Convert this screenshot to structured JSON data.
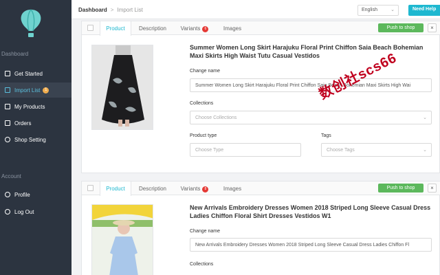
{
  "sidebar": {
    "section_dashboard": "Dashboard",
    "section_account": "Account",
    "items": [
      {
        "label": "Get Started",
        "icon": "external-link-icon"
      },
      {
        "label": "Import List",
        "icon": "list-icon",
        "badge": "1"
      },
      {
        "label": "My Products",
        "icon": "box-icon"
      },
      {
        "label": "Orders",
        "icon": "cart-icon"
      },
      {
        "label": "Shop Setting",
        "icon": "gear-icon"
      }
    ],
    "account_items": [
      {
        "label": "Profile",
        "icon": "user-icon"
      },
      {
        "label": "Log Out",
        "icon": "power-icon"
      }
    ]
  },
  "topbar": {
    "breadcrumb_root": "Dashboard",
    "breadcrumb_sep": ">",
    "breadcrumb_current": "Import List",
    "language": "English",
    "help_label": "Need Help"
  },
  "products": [
    {
      "tabs": {
        "product": "Product",
        "description": "Description",
        "variants": "Variants",
        "variants_count": "6",
        "images": "Images"
      },
      "push_label": "Push to shop",
      "close_label": "×",
      "title": "Summer Women Long Skirt Harajuku Floral Print Chiffon Saia Beach Bohemian Maxi Skirts High Waist Tutu Casual Vestidos",
      "change_name_label": "Change name",
      "change_name_value": "Summer Women Long Skirt Harajuku Floral Print Chiffon Saia Beach Bohemian Maxi Skirts High Wai",
      "collections_label": "Collections",
      "collections_placeholder": "Choose Collections",
      "product_type_label": "Product type",
      "product_type_placeholder": "Choose Type",
      "tags_label": "Tags",
      "tags_placeholder": "Choose Tags"
    },
    {
      "tabs": {
        "product": "Product",
        "description": "Description",
        "variants": "Variants",
        "variants_count": "8",
        "images": "Images"
      },
      "push_label": "Push to shop",
      "close_label": "×",
      "title": "New Arrivals Embroidery Dresses Women 2018 Striped Long Sleeve Casual Dress Ladies Chiffon Floral Shirt Dresses Vestidos W1",
      "change_name_label": "Change name",
      "change_name_value": "New Arrivals Embroidery Dresses Women 2018 Striped Long Sleeve Casual Dress Ladies Chiffon Fl",
      "collections_label": "Collections"
    }
  ],
  "watermark": "数创社scs66",
  "colors": {
    "sidebar": "#2c3440",
    "accent": "#1eb8d0",
    "push": "#5cb85c",
    "badge": "#e53935"
  }
}
